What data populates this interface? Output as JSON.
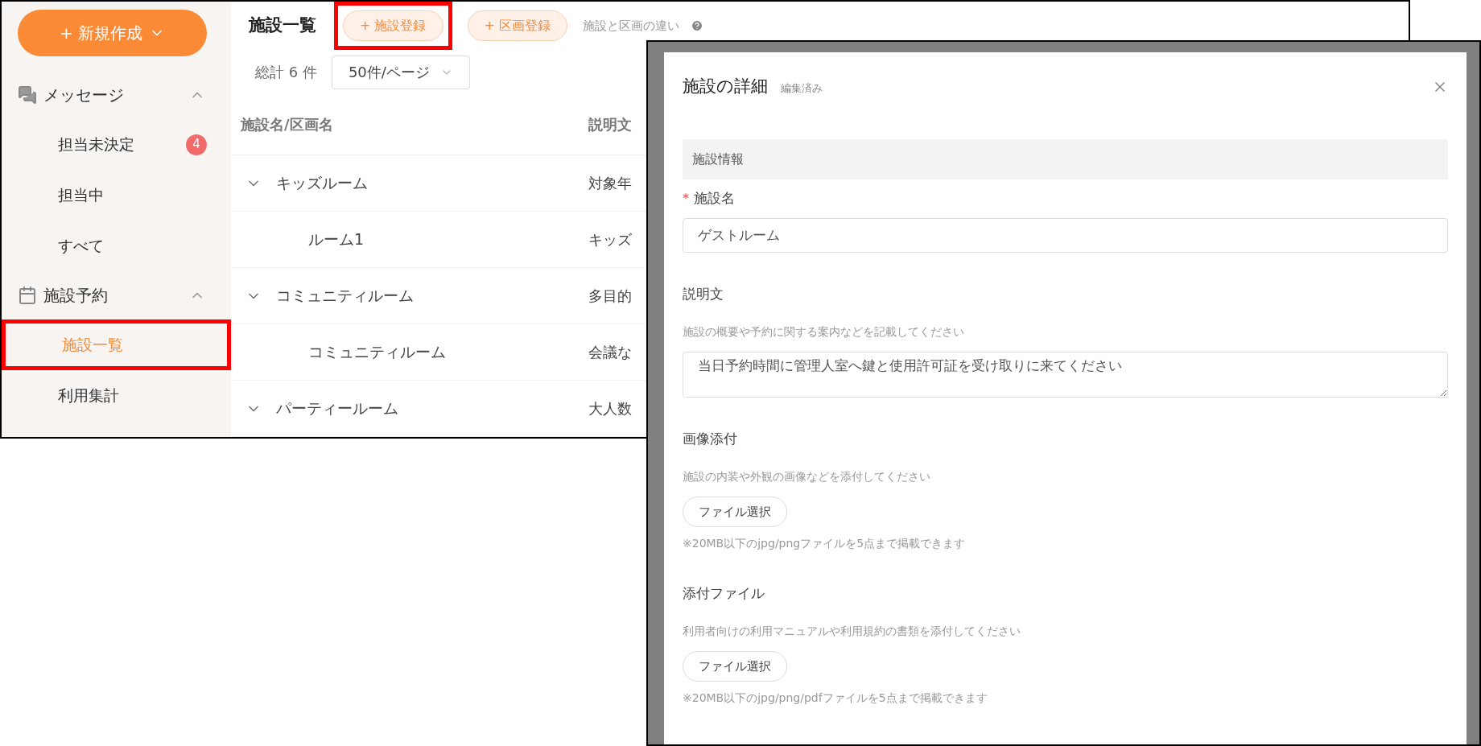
{
  "sidebar": {
    "new_button": {
      "label": "+ 新規作成"
    },
    "sections": [
      {
        "label": "メッセージ",
        "kind": "messages",
        "expanded": true,
        "items": [
          {
            "label": "担当未決定",
            "badge": "4",
            "selected": false,
            "highlighted": false
          },
          {
            "label": "担当中",
            "selected": false,
            "highlighted": false
          },
          {
            "label": "すべて",
            "selected": false,
            "highlighted": false
          }
        ]
      },
      {
        "label": "施設予約",
        "kind": "calendar",
        "expanded": true,
        "items": [
          {
            "label": "施設一覧",
            "selected": true,
            "highlighted": true
          },
          {
            "label": "利用集計",
            "selected": false,
            "highlighted": false
          }
        ]
      }
    ]
  },
  "main": {
    "title": "施設一覧",
    "buttons": [
      {
        "label": "+ 施設登録",
        "highlighted": true
      },
      {
        "label": "+ 区画登録",
        "highlighted": false
      }
    ],
    "help_link": "施設と区画の違い",
    "total": "総計 6 件",
    "page_size": "50件/ページ",
    "table": {
      "columns": [
        "施設名/区画名",
        "説明文"
      ],
      "rows": [
        {
          "name": "キッズルーム",
          "description": "対象年",
          "expanded": true,
          "children": [
            {
              "name": "ルーム1",
              "description": "キッズ"
            }
          ]
        },
        {
          "name": "コミュニティルーム",
          "description": "多目的",
          "expanded": true,
          "children": [
            {
              "name": "コミュニティルーム",
              "description": "会議な"
            }
          ]
        },
        {
          "name": "パーティールーム",
          "description": "大人数",
          "expanded": true
        }
      ]
    }
  },
  "dialog": {
    "title": "施設の詳細",
    "status": "編集済み",
    "section": "施設情報",
    "fields": [
      {
        "kind": "text",
        "label": "施設名",
        "required_mark": "*",
        "value": "ゲストルーム"
      },
      {
        "kind": "textarea",
        "label": "説明文",
        "hint": "施設の概要や予約に関する案内などを記載してください",
        "value": "当日予約時間に管理人室へ鍵と使用許可証を受け取りに来てください"
      },
      {
        "kind": "file",
        "label": "画像添付",
        "hint": "施設の内装や外観の画像などを添付してください",
        "button": "ファイル選択",
        "note": "※20MB以下のjpg/pngファイルを5点まで掲載できます"
      },
      {
        "kind": "file",
        "label": "添付ファイル",
        "hint": "利用者向けの利用マニュアルや利用規約の書類を添付してください",
        "button": "ファイル選択",
        "note": "※20MB以下のjpg/png/pdfファイルを5点まで掲載できます"
      }
    ]
  }
}
